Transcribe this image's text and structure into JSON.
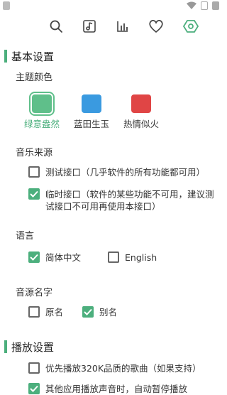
{
  "colors": {
    "accent": "#4caf7d",
    "blue": "#3a9ae0",
    "red": "#e04545"
  },
  "toolbar": {
    "icons": [
      "search-icon",
      "music-note-icon",
      "chart-icon",
      "heart-icon",
      "settings-icon"
    ],
    "active": "settings-icon"
  },
  "basic": {
    "title": "基本设置",
    "theme": {
      "label": "主题颜色",
      "options": [
        {
          "label": "绿意盎然",
          "color": "#5fbf8a",
          "selected": true
        },
        {
          "label": "蓝田生玉",
          "color": "#3a9ae0",
          "selected": false
        },
        {
          "label": "热情似火",
          "color": "#e04545",
          "selected": false
        }
      ]
    },
    "source": {
      "label": "音乐来源",
      "options": [
        {
          "text": "测试接口（几乎软件的所有功能都可用）",
          "checked": false
        },
        {
          "text": "临时接口（软件的某些功能不可用，建议测试接口不可用再使用本接口）",
          "checked": true
        }
      ]
    },
    "language": {
      "label": "语言",
      "options": [
        {
          "text": "简体中文",
          "checked": true
        },
        {
          "text": "English",
          "checked": false
        }
      ]
    },
    "source_name": {
      "label": "音源名字",
      "options": [
        {
          "text": "原名",
          "checked": false
        },
        {
          "text": "别名",
          "checked": true
        }
      ]
    }
  },
  "playback": {
    "title": "播放设置",
    "options": [
      {
        "text": "优先播放320K品质的歌曲（如果支持）",
        "checked": false
      },
      {
        "text": "其他应用播放声音时，自动暂停播放",
        "checked": true
      }
    ]
  }
}
